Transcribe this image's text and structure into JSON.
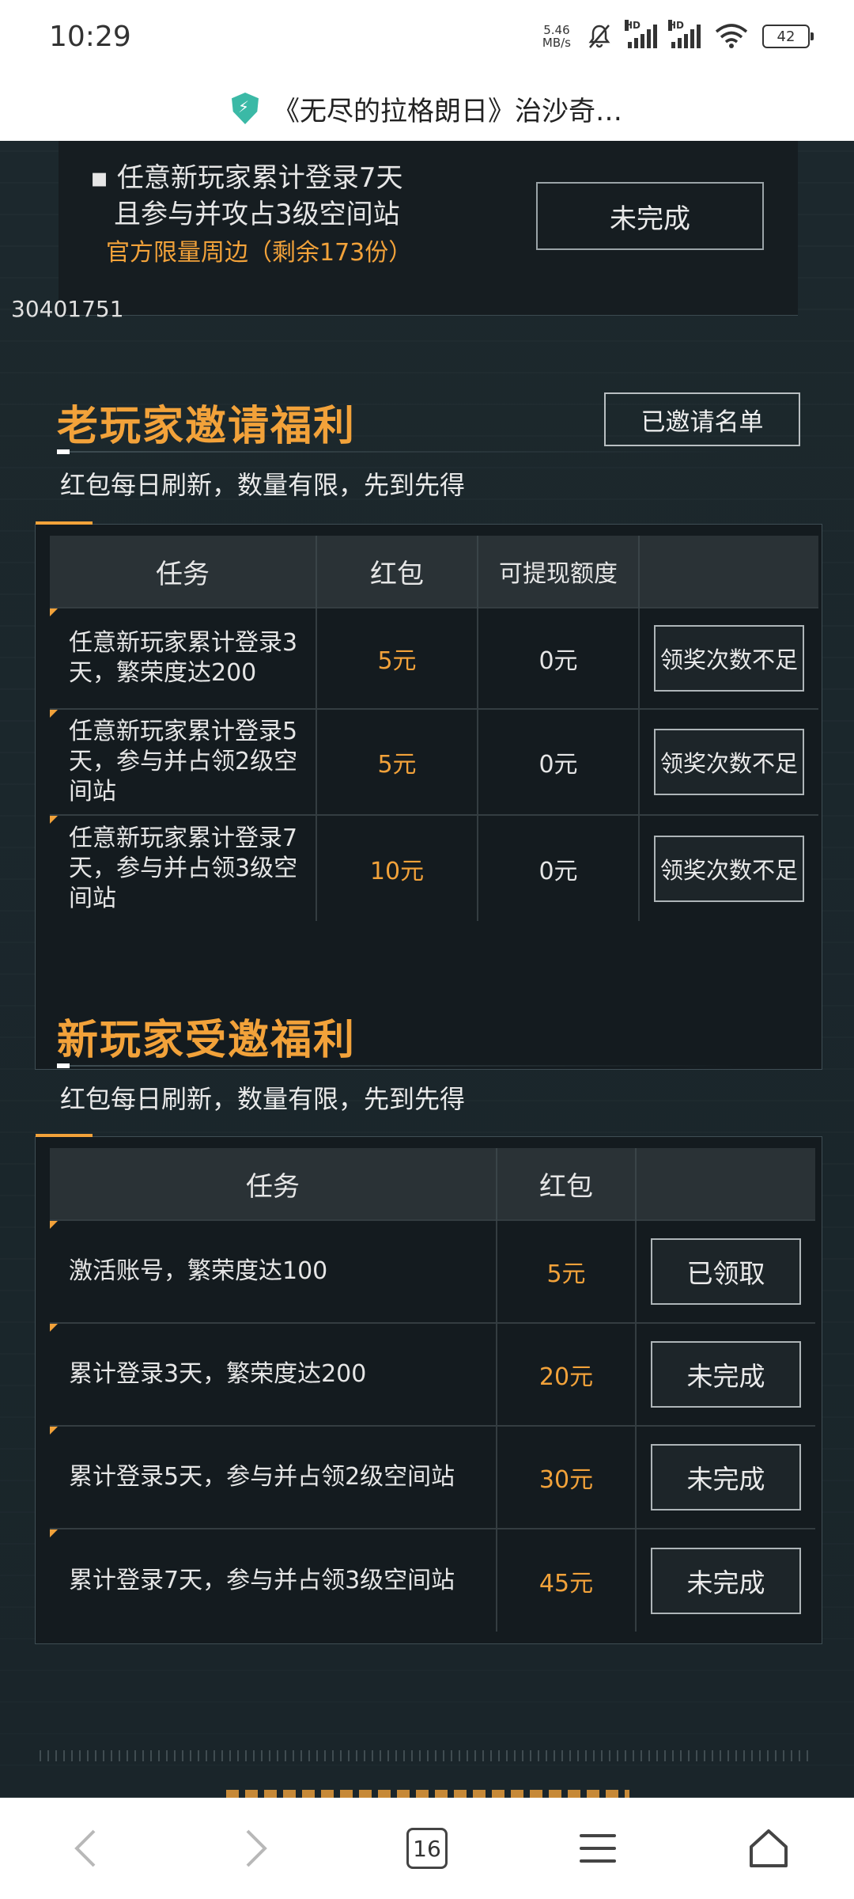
{
  "status_bar": {
    "time": "10:29",
    "net_speed_value": "5.46",
    "net_speed_unit": "MB/s",
    "hd_label": "HD",
    "battery": "42"
  },
  "title_bar": {
    "title": "《无尽的拉格朗日》治沙奇…",
    "icon": "shield-lightning-icon"
  },
  "top_card": {
    "task_line1": "任意新玩家累计登录7天",
    "task_line2": "且参与并攻占3级空间站",
    "reward": "官方限量周边（剩余173份）",
    "button": "未完成",
    "uid": "30401751"
  },
  "old_player": {
    "title": "老玩家邀请福利",
    "subtitle": "红包每日刷新，数量有限，先到先得",
    "invited_list_button": "已邀请名单",
    "headers": [
      "任务",
      "红包",
      "可提现额度",
      ""
    ],
    "rows": [
      {
        "task": "任意新玩家累计登录3天，繁荣度达200",
        "red_packet": "5元",
        "withdraw": "0元",
        "button": "领奖次数不足"
      },
      {
        "task": "任意新玩家累计登录5天，参与并占领2级空间站",
        "red_packet": "5元",
        "withdraw": "0元",
        "button": "领奖次数不足"
      },
      {
        "task": "任意新玩家累计登录7天，参与并占领3级空间站",
        "red_packet": "10元",
        "withdraw": "0元",
        "button": "领奖次数不足"
      }
    ]
  },
  "new_player": {
    "title": "新玩家受邀福利",
    "subtitle": "红包每日刷新，数量有限，先到先得",
    "headers": [
      "任务",
      "红包",
      ""
    ],
    "rows": [
      {
        "task": "激活账号，繁荣度达100",
        "red_packet": "5元",
        "button": "已领取"
      },
      {
        "task": "累计登录3天，繁荣度达200",
        "red_packet": "20元",
        "button": "未完成"
      },
      {
        "task": "累计登录5天，参与并占领2级空间站",
        "red_packet": "30元",
        "button": "未完成"
      },
      {
        "task": "累计登录7天，参与并占领3级空间站",
        "red_packet": "45元",
        "button": "未完成"
      }
    ]
  },
  "nav_bar": {
    "back_icon": "chevron-left-icon",
    "forward_icon": "chevron-right-icon",
    "tab_count": "16",
    "menu_icon": "menu-icon",
    "home_icon": "home-icon"
  },
  "colors": {
    "accent": "#f2a23a",
    "background": "#1c282d",
    "table_header": "#2a3236"
  }
}
